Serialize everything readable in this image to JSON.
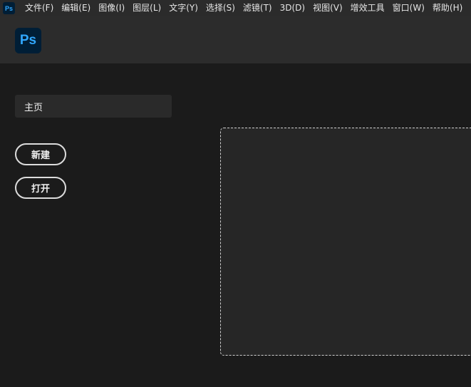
{
  "menubar": {
    "app_icon": "Ps",
    "items": [
      "文件(F)",
      "编辑(E)",
      "图像(I)",
      "图层(L)",
      "文字(Y)",
      "选择(S)",
      "滤镜(T)",
      "3D(D)",
      "视图(V)",
      "增效工具",
      "窗口(W)",
      "帮助(H)"
    ]
  },
  "header": {
    "logo_text": "Ps"
  },
  "sidebar": {
    "home_label": "主页",
    "new_label": "新建",
    "open_label": "打开"
  },
  "colors": {
    "brand_bg": "#001e36",
    "brand_fg": "#31a8ff",
    "background": "#1b1b1b"
  }
}
